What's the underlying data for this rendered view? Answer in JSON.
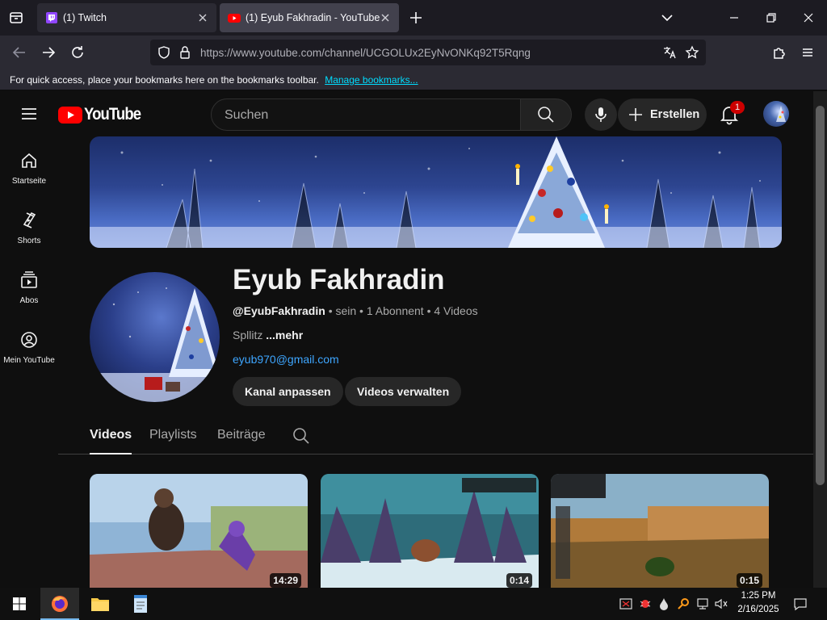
{
  "browser": {
    "tabs": [
      {
        "title": "(1) Twitch",
        "active": false
      },
      {
        "title": "(1) Eyub Fakhradin - YouTube",
        "active": true
      }
    ],
    "url": "https://www.youtube.com/channel/UCGOLUx2EyNvONKq92T5Rqng",
    "bookmarks_prompt": "For quick access, place your bookmarks here on the bookmarks toolbar.",
    "bookmarks_link": "Manage bookmarks..."
  },
  "youtube": {
    "logo": "YouTube",
    "search_placeholder": "Suchen",
    "create_label": "Erstellen",
    "notification_count": "1",
    "guide": [
      {
        "label": "Startseite",
        "icon": "home-icon"
      },
      {
        "label": "Shorts",
        "icon": "shorts-icon"
      },
      {
        "label": "Abos",
        "icon": "subscriptions-icon"
      },
      {
        "label": "Mein YouTube",
        "icon": "you-icon"
      }
    ],
    "channel": {
      "name": "Eyub Fakhradin",
      "handle": "@EyubFakhradin",
      "meta": "• sein • 1 Abonnent • 4 Videos",
      "description": "Spllitz",
      "more": "...mehr",
      "email": "eyub970@gmail.com",
      "customize_button": "Kanal anpassen",
      "manage_button": "Videos verwalten"
    },
    "tabs": [
      "Videos",
      "Playlists",
      "Beiträge"
    ],
    "active_tab": "Videos",
    "videos": [
      {
        "duration": "14:29"
      },
      {
        "duration": "0:14"
      },
      {
        "duration": "0:15"
      }
    ]
  },
  "taskbar": {
    "time": "1:25 PM",
    "date": "2/16/2025"
  },
  "colors": {
    "youtube_red": "#ff0000",
    "link_blue": "#3ea6ff",
    "firefox_link": "#00ddff"
  }
}
